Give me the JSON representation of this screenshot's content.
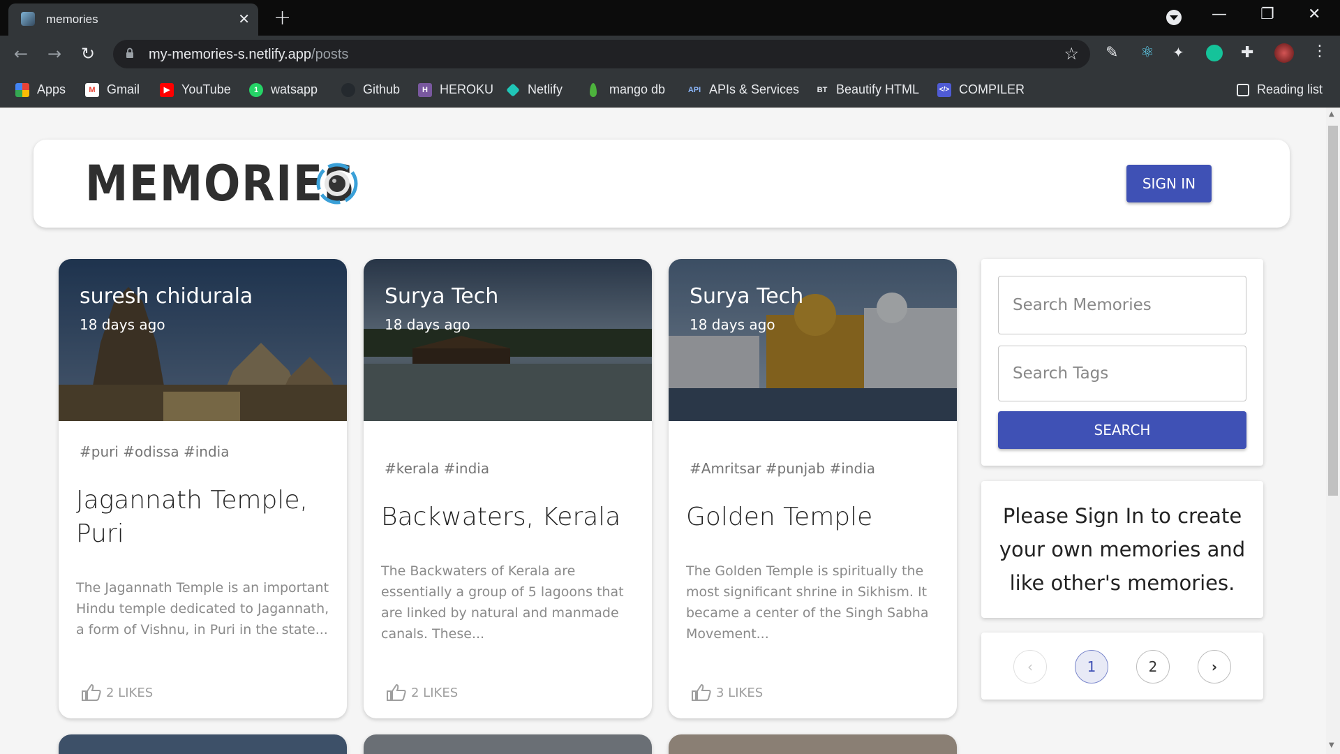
{
  "browser": {
    "tab_title": "memories",
    "url_host": "my-memories-s.netlify.app",
    "url_path": "/posts",
    "bookmarks": [
      {
        "label": "Apps",
        "icon": "apps-grid-icon",
        "color": "#ea4335"
      },
      {
        "label": "Gmail",
        "icon": "gmail-icon",
        "color": "#ea4335"
      },
      {
        "label": "YouTube",
        "icon": "youtube-icon",
        "color": "#ff0000"
      },
      {
        "label": "watsapp",
        "icon": "whatsapp-icon",
        "color": "#25d366"
      },
      {
        "label": "Github",
        "icon": "github-icon",
        "color": "#24292e"
      },
      {
        "label": "HEROKU",
        "icon": "heroku-icon",
        "color": "#79589f"
      },
      {
        "label": "Netlify",
        "icon": "netlify-icon",
        "color": "#20c6b7"
      },
      {
        "label": "mango db",
        "icon": "mongodb-leaf-icon",
        "color": "#4db33d"
      },
      {
        "label": "APIs & Services",
        "icon": "api-icon",
        "color": "#4285f4"
      },
      {
        "label": "Beautify HTML",
        "icon": "beautify-icon",
        "color": "#222222"
      },
      {
        "label": "COMPILER",
        "icon": "code-icon",
        "color": "#4f5bd5"
      }
    ],
    "reading_list": "Reading list"
  },
  "header": {
    "brand": "MEMORIES",
    "signin_label": "SIGN IN",
    "accent": "#3f51b5"
  },
  "posts": [
    {
      "author": "suresh chidurala",
      "ago": "18 days ago",
      "tags": "#puri #odissa #india",
      "title": "Jagannath Temple, Puri",
      "description": "The Jagannath Temple is an important Hindu temple dedicated to Jagannath, a form of Vishnu, in Puri in the state...",
      "likes": "2 LIKES"
    },
    {
      "author": "Surya Tech",
      "ago": "18 days ago",
      "tags": "#kerala #india",
      "title": "Backwaters, Kerala",
      "description": "The Backwaters of Kerala are essentially a group of 5 lagoons that are linked by natural and manmade canals. These...",
      "likes": "2 LIKES"
    },
    {
      "author": "Surya Tech",
      "ago": "18 days ago",
      "tags": "#Amritsar #punjab #india",
      "title": "Golden Temple",
      "description": "The Golden Temple is spiritually the most significant shrine in Sikhism. It became a center of the Singh Sabha Movement...",
      "likes": "3 LIKES"
    }
  ],
  "search": {
    "memories_placeholder": "Search Memories",
    "tags_placeholder": "Search Tags",
    "button_label": "SEARCH"
  },
  "signin_note": "Please Sign In to create your own memories and like other's memories.",
  "pagination": {
    "pages": [
      "1",
      "2"
    ],
    "current": "1",
    "prev": "‹",
    "next": "›"
  }
}
